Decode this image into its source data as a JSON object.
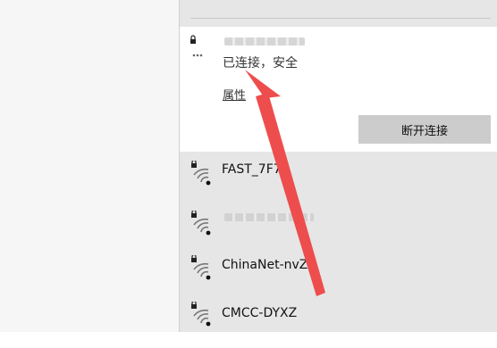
{
  "connected_network": {
    "status": "已连接，安全",
    "properties_link": "属性",
    "disconnect_button": "断开连接"
  },
  "networks": [
    {
      "name": "FAST_7F7"
    },
    {
      "name": ""
    },
    {
      "name": "ChinaNet-nvZ3"
    },
    {
      "name": "CMCC-DYXZ"
    }
  ],
  "colors": {
    "arrow": "#ee4d4d",
    "flyout_bg": "#e6e6e6",
    "button_bg": "#cccccc"
  },
  "icons": {
    "wifi": "wifi-secured-icon"
  }
}
